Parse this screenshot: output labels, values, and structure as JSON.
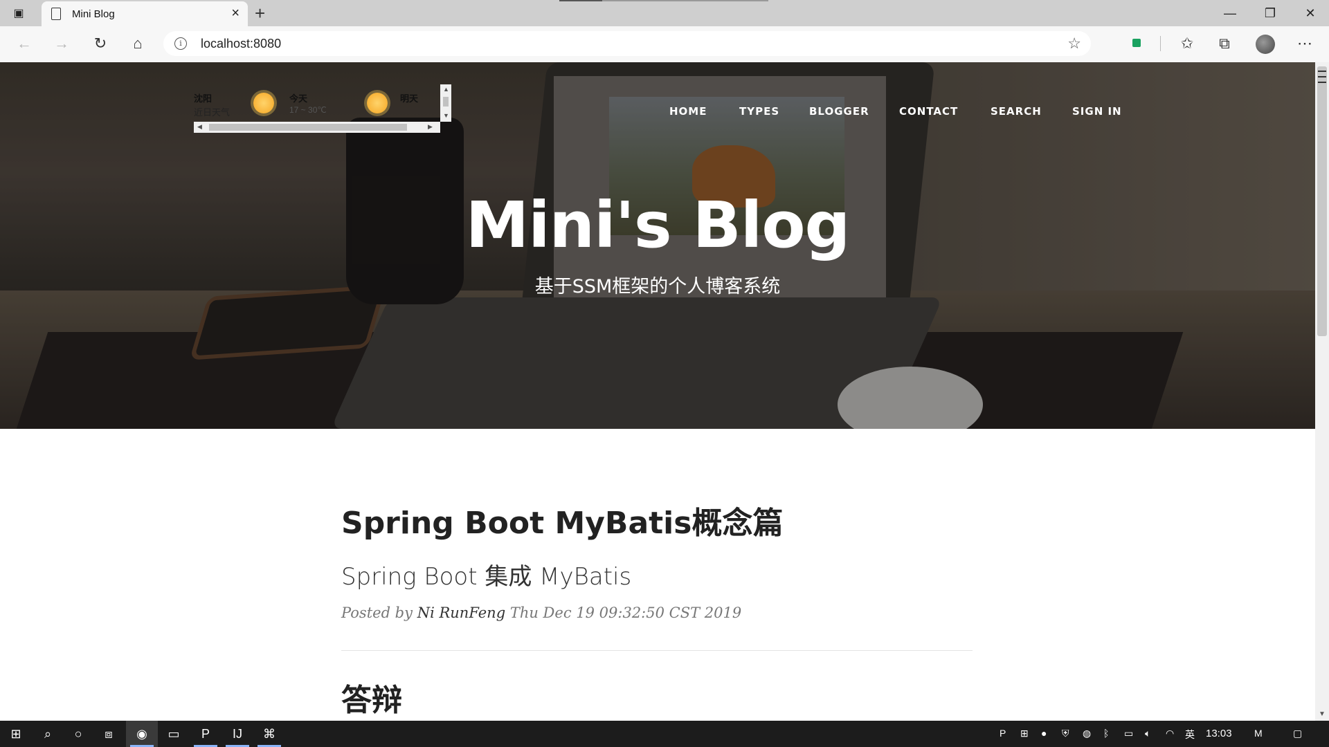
{
  "browser": {
    "tab_title": "Mini Blog",
    "url": "localhost:8080",
    "icons": {
      "tab_actions": "tab-actions-icon",
      "back": "back-arrow-icon",
      "forward": "forward-arrow-icon",
      "refresh": "refresh-icon",
      "home": "home-icon",
      "info": "info-icon",
      "add_favorite": "add-favorite-icon",
      "favorites": "favorites-icon",
      "collections": "collections-icon",
      "more": "more-icon"
    }
  },
  "weather": {
    "city": "沈阳",
    "recent": "近日天气",
    "today_label": "今天",
    "today_temp": "17 ~ 30℃",
    "tomorrow_label": "明天"
  },
  "nav": {
    "items": [
      "HOME",
      "TYPES",
      "BLOGGER",
      "CONTACT",
      "SEARCH",
      "SIGN IN"
    ]
  },
  "hero": {
    "title": "Mini's Blog",
    "subtitle": "基于SSM框架的个人博客系统"
  },
  "post": {
    "title": "Spring Boot MyBatis概念篇",
    "subtitle": "Spring Boot 集成 MyBatis",
    "posted_by": "Posted by",
    "author": "Ni RunFeng",
    "date": "Thu Dec 19 09:32:50 CST 2019",
    "section_heading": "答辩"
  },
  "taskbar": {
    "clock": "13:03",
    "ime": "英"
  }
}
